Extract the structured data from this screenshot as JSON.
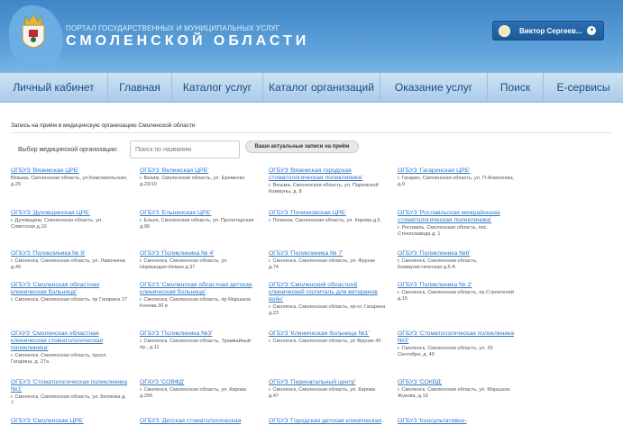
{
  "header": {
    "portal_line1": "ПОРТАЛ ГОСУДАРСТВЕННЫХ И МУНИЦИПАЛЬНЫХ УСЛУГ",
    "portal_line2": "СМОЛЕНСКОЙ ОБЛАСТИ",
    "user_name": "Виктор Сергеев..."
  },
  "nav": [
    "Личный кабинет",
    "Главная",
    "Каталог услуг",
    "Каталог организаций",
    "Оказание услуг",
    "Поиск",
    "Е-сервисы"
  ],
  "page": {
    "breadcrumb": "Запись на приём в медицинскую организацию Смоленской области",
    "filter_label": "Выбор медицинской организации:",
    "search_placeholder": "Поиск по названию",
    "records_button": "Ваши актуальные записи на приём"
  },
  "orgs": [
    {
      "name": "ОГБУЗ 'Вяземская ЦРБ'",
      "addr": "Вязьма, Смоленская область, ул.Комсомольская, д.29"
    },
    {
      "name": "ОГБУЗ 'Велижская ЦРБ'",
      "addr": "г. Велиж, Смоленская область, ул. Еременко д.23/10"
    },
    {
      "name": "ОГБУЗ 'Вяземская городская стоматологическая поликлиника'",
      "addr": "г. Вязьма, Смоленская область, ул. Парижской Коммуны, д. 8"
    },
    {
      "name": "ОГБУЗ 'Гагаринская ЦРБ'",
      "addr": "г. Гагарин, Смоленская область, ул. П-Алексеева, д.9"
    },
    {
      "name": "ОГБУЗ 'Духовщинская ЦРБ'",
      "addr": "г. Духовщина, Смоленская область, ул. Советская д.10"
    },
    {
      "name": "ОГБУЗ 'Ельнинская ЦРБ'",
      "addr": "г. Ельня, Смоленская область, ул. Пролетарская д.96"
    },
    {
      "name": "ОГБУЗ 'Починковская ЦРБ'",
      "addr": "г. Починок, Смоленская область, ул. Кирова д.5"
    },
    {
      "name": "ОГБУЗ 'Рославльская межрайонная стоматологическая поликлиника'",
      "addr": "г. Рославль, Смоленская область, пос. Стеклозавода д. 1"
    },
    {
      "name": "ОГБУЗ 'Поликлиника № 8'",
      "addr": "г. Смоленск, Смоленская область, ул. Лавочкина д.49"
    },
    {
      "name": "ОГБУЗ 'Поликлиника № 4'",
      "addr": "г. Смоленск, Смоленская область, ул. Нормандия-Неман д.37"
    },
    {
      "name": "ОГБУЗ 'Поликлиника № 7'",
      "addr": "г. Смоленск, Смоленская область, ул. Фрунзе д.74"
    },
    {
      "name": "ОГБУЗ 'Поликлиника №6'",
      "addr": "г. Смоленск, Смоленская область, Коммунистическая д.5 А"
    },
    {
      "name": "ОГБУЗ 'Смоленская областная клиническая больница'",
      "addr": "г. Смоленск, Смоленская область, пр Гагарина 27"
    },
    {
      "name": "ОГБУЗ 'Смоленская областная детская клиническая больница'",
      "addr": "г. Смоленск, Смоленская область, пр Маршала Конева 30 в"
    },
    {
      "name": "ОГБУЗ 'Смоленский областной клинический госпиталь для ветеранов войн'",
      "addr": "г. Смоленск, Смоленская область, пр-кт. Гагарина д.23"
    },
    {
      "name": "ОГБУЗ 'Поликлиника № 2'",
      "addr": "г. Смоленск, Смоленская область, пр.Строителей д.15"
    },
    {
      "name": "ОГАУЗ 'Смоленская областная клиническая стоматологическая поликлиника'",
      "addr": "г. Смоленск, Смоленская область, просп. Гагарина, д. 27а"
    },
    {
      "name": "ОГБУЗ 'Поликлиника №3'",
      "addr": "г. Смоленск, Смоленская область, Трамвайный пр., д.11"
    },
    {
      "name": "ОГБУЗ 'Клиническая больница №1'",
      "addr": "г. Смоленск, Смоленская область, ул Фрунзе 40"
    },
    {
      "name": "ОГБУЗ 'Стоматологическая поликлиника №3'",
      "addr": "г. Смоленск, Смоленская область, ул. 25 Сентября, д. 40"
    },
    {
      "name": "ОГБУЗ 'Стоматологическая поликлиника №1'",
      "addr": "г. Смоленск, Смоленская область, ул. Беляева д. 7"
    },
    {
      "name": "ОГАУЗ 'СОВФД'",
      "addr": "г. Смоленск, Смоленская область, ул. Кирова д.29б"
    },
    {
      "name": "ОГБУЗ 'Перинатальный центр'",
      "addr": "г. Смоленск, Смоленская область, ул. Кирова д.47"
    },
    {
      "name": "ОГБУЗ 'СОКВД'",
      "addr": "г. Смоленск, Смоленская область, ул. Маршала Жукова, д.19"
    },
    {
      "name": "ОГБУЗ 'Смоленская ЦРБ'",
      "addr": ""
    },
    {
      "name": "ОГБУЗ 'Детская стоматологическая",
      "addr": ""
    },
    {
      "name": "ОГБУЗ 'Городская детская клиническая",
      "addr": ""
    },
    {
      "name": "ОГБУЗ 'Консультативно-",
      "addr": ""
    }
  ],
  "colors": {
    "header_blue": "#4a8fcd",
    "link_blue": "#2f79c4",
    "nav_text": "#1d4d7f",
    "user_button": "#1d5a98"
  }
}
